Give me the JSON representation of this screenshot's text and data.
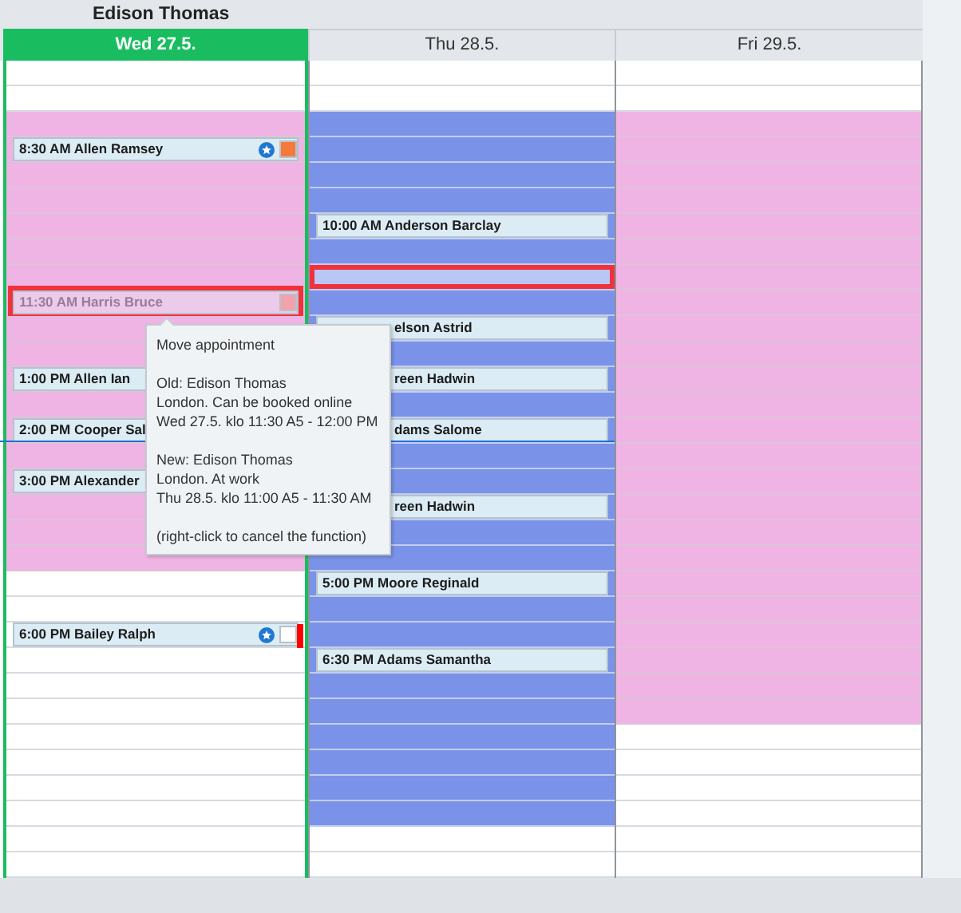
{
  "resource": {
    "name": "Edison Thomas"
  },
  "current_time_line": true,
  "days": [
    {
      "label": "Wed 27.5.",
      "selected": true,
      "slots": [
        {
          "kind": "free"
        },
        {
          "kind": "free"
        },
        {
          "kind": "online"
        },
        {
          "kind": "online",
          "appointment": {
            "text": "8:30 AM Allen Ramsey",
            "online_icon": true,
            "color": "#f47a3c",
            "dragging": false,
            "covered": false
          }
        },
        {
          "kind": "online"
        },
        {
          "kind": "online"
        },
        {
          "kind": "online"
        },
        {
          "kind": "online"
        },
        {
          "kind": "online"
        },
        {
          "kind": "online",
          "appointment": {
            "text": "11:30 AM Harris Bruce",
            "color": "#f2a2ac",
            "dragging": true,
            "covered": false
          }
        },
        {
          "kind": "online"
        },
        {
          "kind": "online"
        },
        {
          "kind": "online",
          "appointment": {
            "text": "1:00 PM Allen Ian",
            "dragging": false,
            "covered": false
          }
        },
        {
          "kind": "online"
        },
        {
          "kind": "online",
          "appointment": {
            "text": "2:00 PM Cooper Sal",
            "dragging": false,
            "covered": false
          }
        },
        {
          "kind": "online"
        },
        {
          "kind": "online",
          "appointment": {
            "text": "3:00 PM Alexander",
            "dragging": false,
            "covered": false
          }
        },
        {
          "kind": "online"
        },
        {
          "kind": "online"
        },
        {
          "kind": "online"
        },
        {
          "kind": "free"
        },
        {
          "kind": "free"
        },
        {
          "kind": "free",
          "appointment": {
            "text": "6:00 PM Bailey Ralph",
            "online_icon": true,
            "color": "#ffffff",
            "flag": true,
            "dragging": false,
            "covered": false
          }
        },
        {
          "kind": "free"
        },
        {
          "kind": "free"
        },
        {
          "kind": "free"
        },
        {
          "kind": "free"
        },
        {
          "kind": "free"
        },
        {
          "kind": "free"
        },
        {
          "kind": "free"
        },
        {
          "kind": "free"
        },
        {
          "kind": "free"
        }
      ]
    },
    {
      "label": "Thu 28.5.",
      "selected": false,
      "slots": [
        {
          "kind": "free"
        },
        {
          "kind": "free"
        },
        {
          "kind": "work"
        },
        {
          "kind": "work"
        },
        {
          "kind": "work"
        },
        {
          "kind": "work"
        },
        {
          "kind": "work",
          "appointment": {
            "text": "10:00 AM Anderson Barclay",
            "dragging": false,
            "covered": false
          }
        },
        {
          "kind": "work"
        },
        {
          "kind": "work",
          "drop_target": true
        },
        {
          "kind": "work"
        },
        {
          "kind": "work",
          "appointment": {
            "text": "elson Astrid",
            "dragging": false,
            "covered": true
          }
        },
        {
          "kind": "work"
        },
        {
          "kind": "work",
          "appointment": {
            "text": "reen Hadwin",
            "dragging": false,
            "covered": true
          }
        },
        {
          "kind": "work"
        },
        {
          "kind": "work",
          "appointment": {
            "text": "dams Salome",
            "dragging": false,
            "covered": true
          }
        },
        {
          "kind": "work"
        },
        {
          "kind": "work"
        },
        {
          "kind": "work",
          "appointment": {
            "text": "reen Hadwin",
            "dragging": false,
            "covered": true
          }
        },
        {
          "kind": "work"
        },
        {
          "kind": "work"
        },
        {
          "kind": "work",
          "appointment": {
            "text": "5:00 PM Moore Reginald",
            "dragging": false,
            "covered": false
          }
        },
        {
          "kind": "work"
        },
        {
          "kind": "work"
        },
        {
          "kind": "work",
          "appointment": {
            "text": "6:30 PM Adams Samantha",
            "dragging": false,
            "covered": false
          }
        },
        {
          "kind": "work"
        },
        {
          "kind": "work"
        },
        {
          "kind": "work"
        },
        {
          "kind": "work"
        },
        {
          "kind": "work"
        },
        {
          "kind": "work"
        },
        {
          "kind": "free"
        },
        {
          "kind": "free"
        }
      ]
    },
    {
      "label": "Fri 29.5.",
      "selected": false,
      "slots": [
        {
          "kind": "free"
        },
        {
          "kind": "free"
        },
        {
          "kind": "online"
        },
        {
          "kind": "online"
        },
        {
          "kind": "online"
        },
        {
          "kind": "online"
        },
        {
          "kind": "online"
        },
        {
          "kind": "online"
        },
        {
          "kind": "online"
        },
        {
          "kind": "online"
        },
        {
          "kind": "online"
        },
        {
          "kind": "online"
        },
        {
          "kind": "online"
        },
        {
          "kind": "online"
        },
        {
          "kind": "online"
        },
        {
          "kind": "online"
        },
        {
          "kind": "online"
        },
        {
          "kind": "online"
        },
        {
          "kind": "online"
        },
        {
          "kind": "online"
        },
        {
          "kind": "online"
        },
        {
          "kind": "online"
        },
        {
          "kind": "online"
        },
        {
          "kind": "online"
        },
        {
          "kind": "online"
        },
        {
          "kind": "online"
        },
        {
          "kind": "free"
        },
        {
          "kind": "free"
        },
        {
          "kind": "free"
        },
        {
          "kind": "free"
        },
        {
          "kind": "free"
        },
        {
          "kind": "free"
        }
      ]
    }
  ],
  "tooltip": {
    "paragraphs": [
      [
        "Move appointment"
      ],
      [
        "Old: Edison Thomas",
        "London. Can be booked online",
        "Wed 27.5. klo 11:30 A5 - 12:00 PM"
      ],
      [
        "New: Edison Thomas",
        "London. At work",
        "Thu 28.5. klo 11:00 A5 - 11:30 AM"
      ],
      [
        "(right-click to cancel the function)"
      ]
    ]
  }
}
